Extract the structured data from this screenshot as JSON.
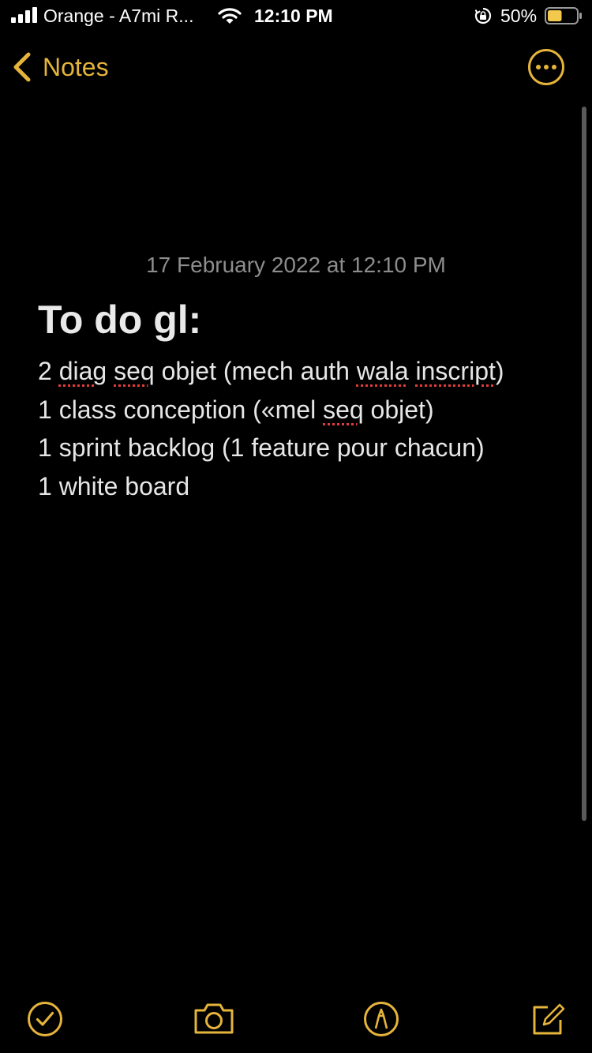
{
  "status_bar": {
    "carrier": "Orange - A7mi R...",
    "time": "12:10 PM",
    "battery_percent": "50%",
    "battery_level": 0.5,
    "icons": [
      "signal-icon",
      "wifi-icon",
      "orientation-lock-icon",
      "battery-icon"
    ]
  },
  "nav": {
    "back_label": "Notes",
    "back_icon": "chevron-left-icon",
    "more_icon": "more-icon"
  },
  "note": {
    "date": "17 February 2022 at 12:10 PM",
    "title": "To do gl:",
    "lines": [
      {
        "parts": [
          {
            "text": "2 "
          },
          {
            "text": "diag",
            "misspelled": true
          },
          {
            "text": " "
          },
          {
            "text": "seq",
            "misspelled": true
          },
          {
            "text": " objet (mech auth "
          },
          {
            "text": "wala",
            "misspelled": true
          },
          {
            "text": " "
          },
          {
            "text": "inscript",
            "misspelled": true
          },
          {
            "text": ")"
          }
        ]
      },
      {
        "parts": [
          {
            "text": "1 class conception («mel "
          },
          {
            "text": "seq",
            "misspelled": true
          },
          {
            "text": " objet)"
          }
        ]
      },
      {
        "parts": [
          {
            "text": "1 sprint backlog (1 feature pour chacun)"
          }
        ]
      },
      {
        "parts": [
          {
            "text": "1 white board"
          }
        ]
      }
    ]
  },
  "toolbar": {
    "icons": [
      "checklist-icon",
      "camera-icon",
      "markup-icon",
      "compose-icon"
    ]
  },
  "colors": {
    "accent": "#e5b43b",
    "background": "#000000",
    "text": "#e6e6e6",
    "date_text": "#8d8d8d",
    "battery_fill": "#f2c94c",
    "spellcheck": "#e03b3b"
  }
}
